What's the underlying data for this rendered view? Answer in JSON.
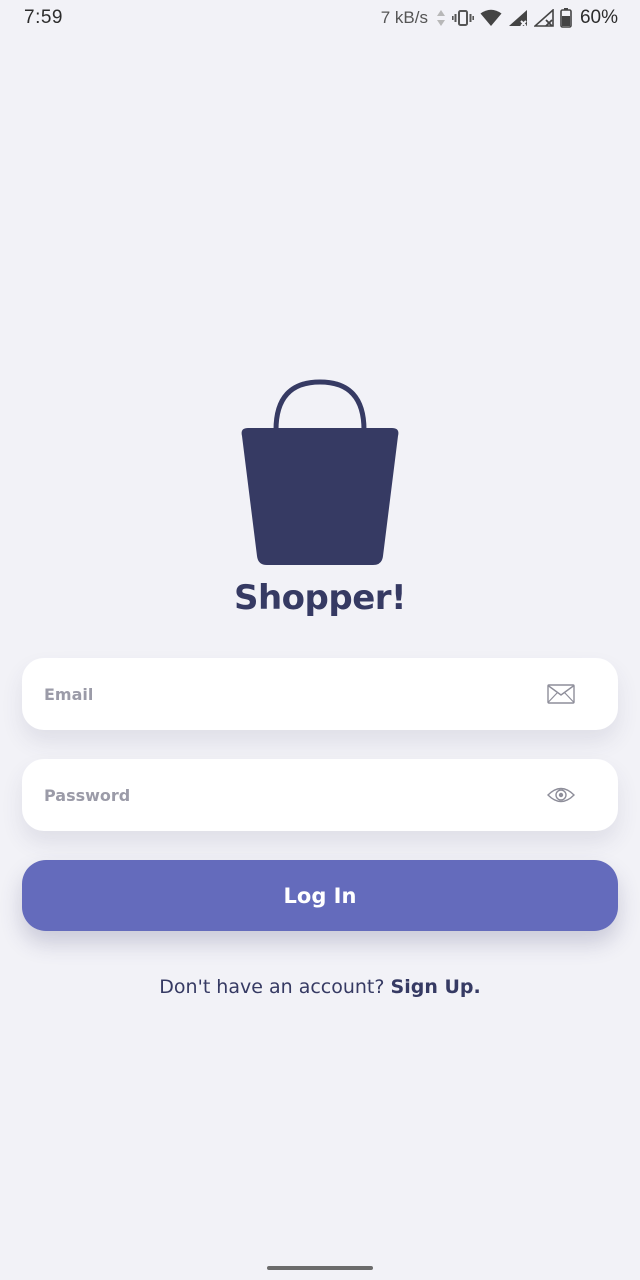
{
  "status_bar": {
    "time": "7:59",
    "network_speed": "7 kB/s",
    "battery_percent": "60%",
    "icons": [
      "data-arrows-icon",
      "vibrate-icon",
      "wifi-icon",
      "signal-icon",
      "signal-no-sim-icon",
      "battery-icon"
    ]
  },
  "brand": {
    "logo_icon": "shopping-bag-icon",
    "title": "Shopper!",
    "logo_color": "#363a63"
  },
  "form": {
    "email": {
      "placeholder": "Email",
      "value": "",
      "icon": "envelope-icon"
    },
    "password": {
      "placeholder": "Password",
      "value": "",
      "icon": "eye-icon"
    },
    "login_label": "Log In"
  },
  "signup": {
    "prompt": "Don't have an account?",
    "link_label": "Sign Up."
  },
  "colors": {
    "background": "#f2f2f7",
    "primary": "#646bbc",
    "text_dark": "#363a63",
    "field_bg": "#ffffff",
    "placeholder": "#9b9ba8"
  }
}
